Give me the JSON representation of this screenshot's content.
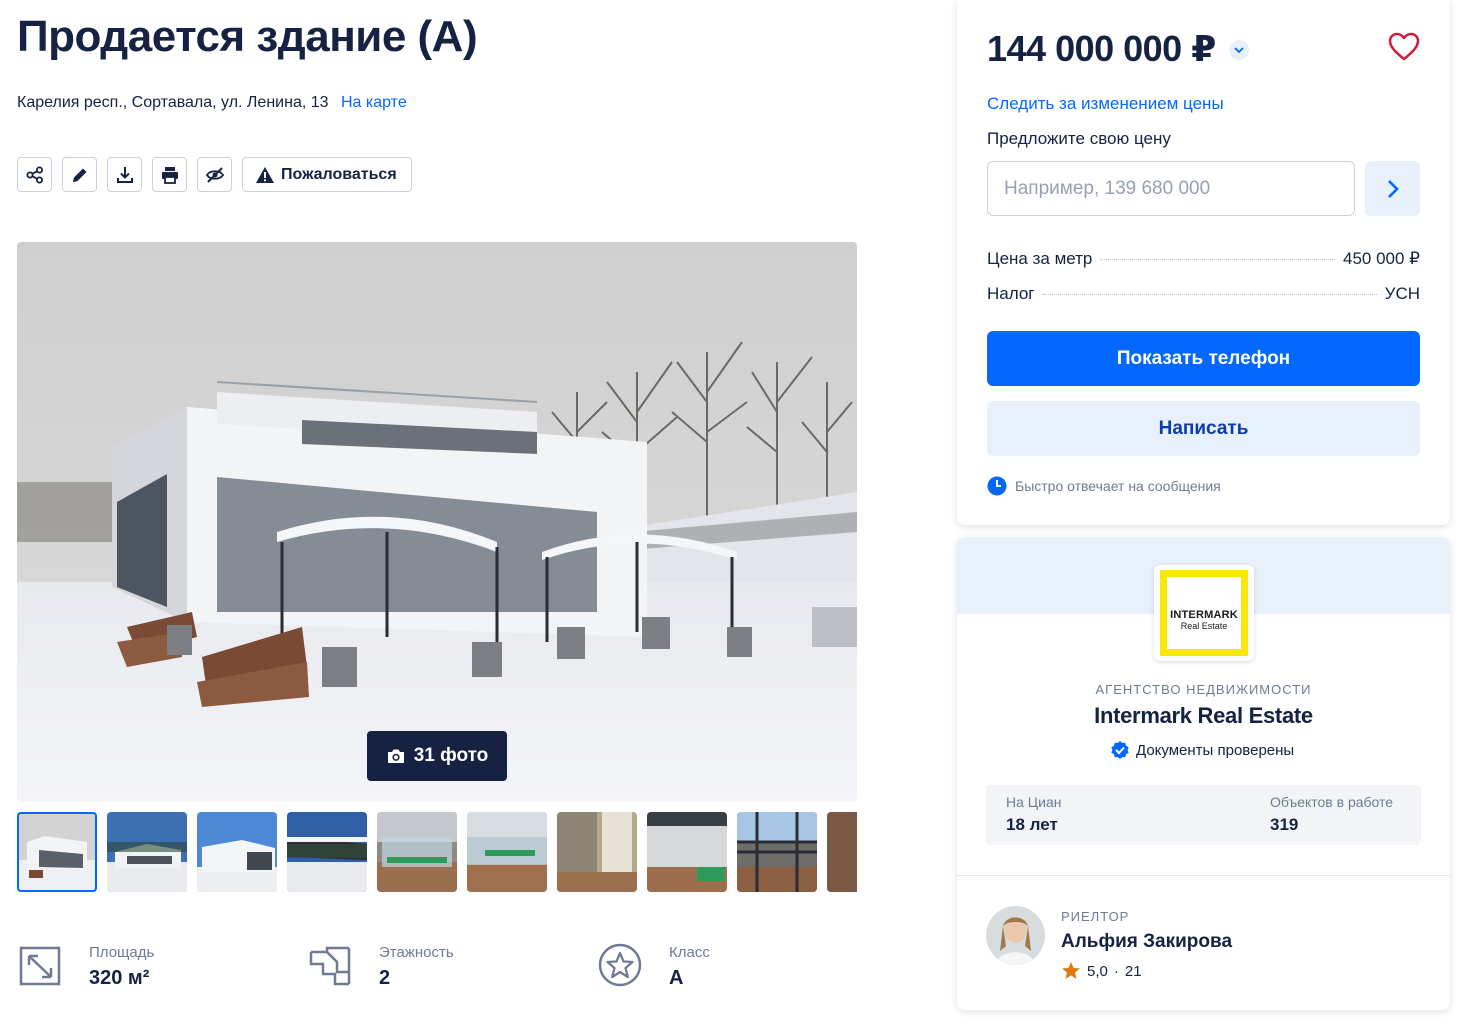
{
  "listing": {
    "title": "Продается здание (А)",
    "address": "Карелия респ., Сортавала, ул. Ленина, 13",
    "map_link": "На карте"
  },
  "toolbar": {
    "report_label": "Пожаловаться",
    "icons": [
      "share-icon",
      "edit-icon",
      "download-icon",
      "print-icon",
      "hide-icon",
      "warning-icon"
    ]
  },
  "gallery": {
    "photo_count": "31 фото",
    "thumbnail_count": 10,
    "active_thumbnail": 0
  },
  "facts": [
    {
      "label": "Площадь",
      "value": "320 м²",
      "icon": "area-icon"
    },
    {
      "label": "Этажность",
      "value": "2",
      "icon": "stairs-icon"
    },
    {
      "label": "Класс",
      "value": "А",
      "icon": "star-icon"
    }
  ],
  "price_card": {
    "price": "144 000 000 ₽",
    "follow_price": "Следить за изменением цены",
    "offer_label": "Предложите свою цену",
    "offer_placeholder": "Например, 139 680 000",
    "rows": [
      {
        "label": "Цена за метр",
        "value": "450 000 ₽"
      },
      {
        "label": "Налог",
        "value": "УСН"
      }
    ],
    "show_phone": "Показать телефон",
    "write": "Написать",
    "quick_reply": "Быстро отвечает на сообщения"
  },
  "agency": {
    "logo_main": "INTERMARK",
    "logo_sub": "Real Estate",
    "category": "АГЕНТСТВО НЕДВИЖИМОСТИ",
    "name": "Intermark Real Estate",
    "verified": "Документы проверены",
    "stats": [
      {
        "label": "На Циан",
        "value": "18 лет"
      },
      {
        "label": "Объектов в работе",
        "value": "319"
      }
    ]
  },
  "realtor": {
    "role": "РИЕЛТОР",
    "name": "Альфия Закирова",
    "rating": "5,0",
    "reviews": "21",
    "separator": "·"
  },
  "colors": {
    "primary": "#0468ff",
    "text": "#152242",
    "muted": "#707a95",
    "light_blue": "#e8f0fc",
    "favorite": "#d11f3c",
    "star": "#e07a10",
    "logo_yellow": "#f7e70a"
  }
}
